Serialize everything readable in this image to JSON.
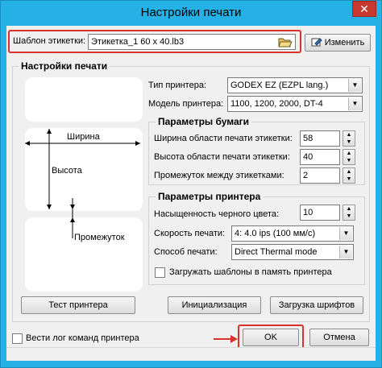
{
  "window": {
    "title": "Настройки печати",
    "close_glyph": "✕"
  },
  "template": {
    "label": "Шаблон этикетки:",
    "value": "Этикетка_1 60 x 40.lb3",
    "browse_icon": "folder-open-icon",
    "change_button": "Изменить",
    "change_icon": "edit-icon"
  },
  "print_settings": {
    "title": "Настройки печати",
    "printer_type_label": "Тип принтера:",
    "printer_type_value": "GODEX EZ (EZPL lang.)",
    "printer_model_label": "Модель принтера:",
    "printer_model_value": "1100, 1200, 2000, DT-4"
  },
  "diagram": {
    "width": "Ширина",
    "height": "Высота",
    "gap": "Промежуток"
  },
  "paper": {
    "title": "Параметры бумаги",
    "width_label": "Ширина области печати этикетки:",
    "width_value": "58",
    "height_label": "Высота области печати этикетки:",
    "height_value": "40",
    "gap_label": "Промежуток между этикетками:",
    "gap_value": "2"
  },
  "printer": {
    "title": "Параметры принтера",
    "darkness_label": "Насыщенность черного цвета:",
    "darkness_value": "10",
    "speed_label": "Скорость печати:",
    "speed_value": "4: 4.0 ips (100 мм/с)",
    "method_label": "Способ печати:",
    "method_value": "Direct Thermal mode",
    "load_templates_label": "Загружать шаблоны в память принтера",
    "load_templates_checked": false
  },
  "buttons": {
    "test": "Тест принтера",
    "init": "Инициализация",
    "fonts": "Загрузка шрифтов",
    "ok": "OK",
    "cancel": "Отмена"
  },
  "log": {
    "label": "Вести лог команд принтера",
    "checked": false
  },
  "colors": {
    "titlebar": "#26b1e6",
    "highlight": "#d9322b",
    "close": "#c7392e"
  }
}
